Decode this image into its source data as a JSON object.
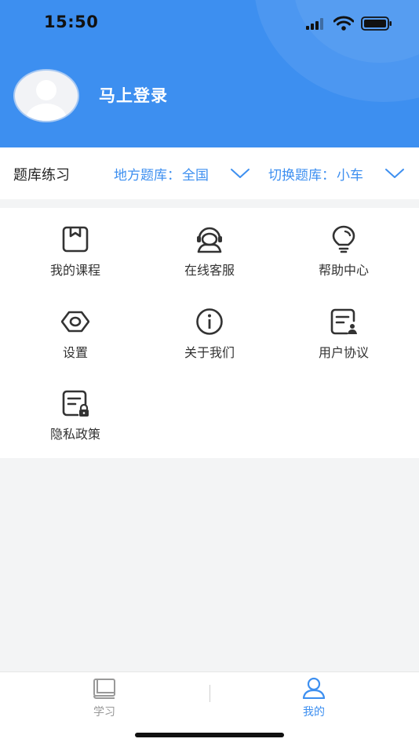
{
  "status_bar": {
    "time": "15:50"
  },
  "profile": {
    "login_label": "马上登录"
  },
  "bank_bar": {
    "title": "题库练习",
    "region_label": "地方题库：",
    "region_value": "全国",
    "switch_label": "切换题库：",
    "switch_value": "小车"
  },
  "menu": {
    "items": [
      {
        "label": "我的课程",
        "icon": "book-icon"
      },
      {
        "label": "在线客服",
        "icon": "headset-icon"
      },
      {
        "label": "帮助中心",
        "icon": "lightbulb-icon"
      },
      {
        "label": "设置",
        "icon": "settings-icon"
      },
      {
        "label": "关于我们",
        "icon": "info-icon"
      },
      {
        "label": "用户协议",
        "icon": "user-agreement-icon"
      },
      {
        "label": "隐私政策",
        "icon": "privacy-lock-icon"
      }
    ]
  },
  "tabbar": {
    "tabs": [
      {
        "label": "学习",
        "icon": "book-stack-icon",
        "active": false
      },
      {
        "label": "我的",
        "icon": "person-icon",
        "active": true
      }
    ]
  },
  "colors": {
    "accent": "#3d8ff0",
    "header_bg": "#3d8ff0",
    "inactive_tab": "#999999"
  }
}
